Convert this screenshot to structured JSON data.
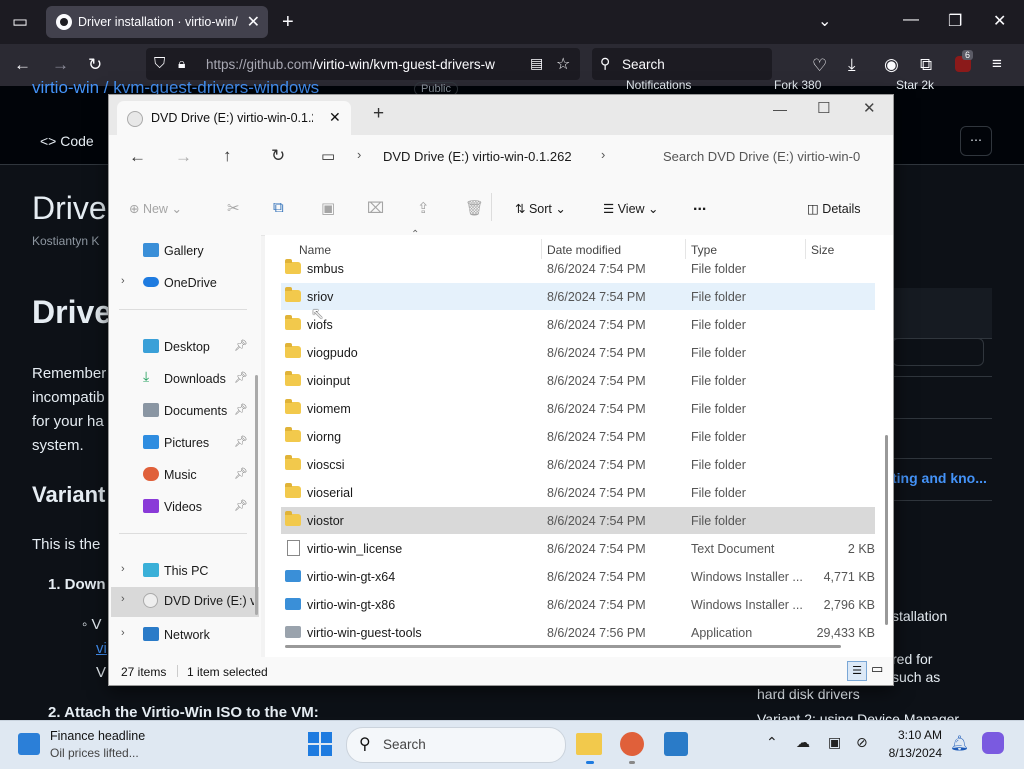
{
  "browser": {
    "tab_title": "Driver installation · virtio-win/k",
    "url_host": "https://github.com",
    "url_path": "/virtio-win/kvm-guest-drivers-w",
    "search_placeholder": "Search",
    "extension_badge": "6"
  },
  "github": {
    "repo_crumb": "virtio-win / kvm-guest-drivers-windows",
    "public_label": "Public",
    "notifications_label": "Notifications",
    "fork_label": "Fork",
    "fork_count": "380",
    "star_label": "Star",
    "star_count": "2k",
    "code_tab": "Code",
    "page_title_partial": "Drive",
    "author_partial": "Kostiantyn K",
    "heading_partial": "Drive",
    "para_lines": [
      "Remember",
      "incompatib",
      "for your ha",
      "system."
    ],
    "variant_heading": "Variant",
    "this_is_the": "This is the",
    "step1": "1. Down",
    "sub_bullet": "V",
    "sub_link": "vi",
    "sub_v": "V",
    "step2": "2. Attach the Virtio-Win ISO to the VM:",
    "right_link": "ting and kno...",
    "right_text1": "stallation",
    "right_text2": "red for",
    "right_text3": "such as",
    "right_text4": "hard disk drivers",
    "right_text5": "Variant 2: using Device Manager"
  },
  "explorer": {
    "tab_title": "DVD Drive (E:) virtio-win-0.1.2(",
    "address_label": "DVD Drive (E:) virtio-win-0.1.262",
    "search_placeholder": "Search DVD Drive (E:) virtio-win-0",
    "toolbar": {
      "new_label": "New",
      "sort_label": "Sort",
      "view_label": "View",
      "more_label": "...",
      "details_label": "Details"
    },
    "columns": {
      "name": "Name",
      "date": "Date modified",
      "type": "Type",
      "size": "Size"
    },
    "sidebar": [
      {
        "label": "Gallery",
        "icon": "gallery-icon"
      },
      {
        "label": "OneDrive",
        "icon": "cloud-icon"
      },
      {
        "label": "Desktop",
        "icon": "desktop-icon"
      },
      {
        "label": "Downloads",
        "icon": "download-icon"
      },
      {
        "label": "Documents",
        "icon": "documents-icon"
      },
      {
        "label": "Pictures",
        "icon": "pictures-icon"
      },
      {
        "label": "Music",
        "icon": "music-icon"
      },
      {
        "label": "Videos",
        "icon": "videos-icon"
      },
      {
        "label": "This PC",
        "icon": "pc-icon"
      },
      {
        "label": "DVD Drive (E:) vi",
        "icon": "dvd-icon"
      },
      {
        "label": "Network",
        "icon": "network-icon"
      }
    ],
    "files": [
      {
        "name": "smbus",
        "date": "8/6/2024 7:54 PM",
        "type": "File folder",
        "size": "",
        "kind": "folder"
      },
      {
        "name": "sriov",
        "date": "8/6/2024 7:54 PM",
        "type": "File folder",
        "size": "",
        "kind": "folder"
      },
      {
        "name": "viofs",
        "date": "8/6/2024 7:54 PM",
        "type": "File folder",
        "size": "",
        "kind": "folder"
      },
      {
        "name": "viogpudo",
        "date": "8/6/2024 7:54 PM",
        "type": "File folder",
        "size": "",
        "kind": "folder"
      },
      {
        "name": "vioinput",
        "date": "8/6/2024 7:54 PM",
        "type": "File folder",
        "size": "",
        "kind": "folder"
      },
      {
        "name": "viomem",
        "date": "8/6/2024 7:54 PM",
        "type": "File folder",
        "size": "",
        "kind": "folder"
      },
      {
        "name": "viorng",
        "date": "8/6/2024 7:54 PM",
        "type": "File folder",
        "size": "",
        "kind": "folder"
      },
      {
        "name": "vioscsi",
        "date": "8/6/2024 7:54 PM",
        "type": "File folder",
        "size": "",
        "kind": "folder"
      },
      {
        "name": "vioserial",
        "date": "8/6/2024 7:54 PM",
        "type": "File folder",
        "size": "",
        "kind": "folder"
      },
      {
        "name": "viostor",
        "date": "8/6/2024 7:54 PM",
        "type": "File folder",
        "size": "",
        "kind": "folder"
      },
      {
        "name": "virtio-win_license",
        "date": "8/6/2024 7:54 PM",
        "type": "Text Document",
        "size": "2 KB",
        "kind": "doc"
      },
      {
        "name": "virtio-win-gt-x64",
        "date": "8/6/2024 7:54 PM",
        "type": "Windows Installer ...",
        "size": "4,771 KB",
        "kind": "msi"
      },
      {
        "name": "virtio-win-gt-x86",
        "date": "8/6/2024 7:54 PM",
        "type": "Windows Installer ...",
        "size": "2,796 KB",
        "kind": "msi"
      },
      {
        "name": "virtio-win-guest-tools",
        "date": "8/6/2024 7:56 PM",
        "type": "Application",
        "size": "29,433 KB",
        "kind": "app"
      }
    ],
    "status_count": "27 items",
    "status_selected": "1 item selected"
  },
  "taskbar": {
    "news_headline": "Finance headline",
    "news_sub": "Oil prices lifted...",
    "search_label": "Search",
    "time": "3:10 AM",
    "date": "8/13/2024"
  }
}
